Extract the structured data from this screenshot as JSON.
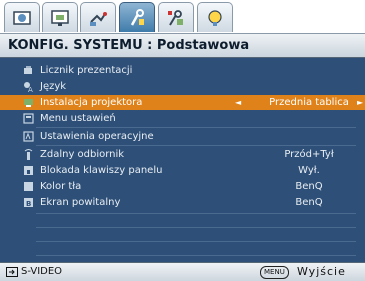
{
  "tabs": [
    {
      "icon": "picture-icon",
      "active": false
    },
    {
      "icon": "display-icon",
      "active": false
    },
    {
      "icon": "connection-icon",
      "active": false
    },
    {
      "icon": "system-setup-icon",
      "active": true
    },
    {
      "icon": "advanced-setup-icon",
      "active": false
    },
    {
      "icon": "information-icon",
      "active": false
    }
  ],
  "title": "KONFIG. SYSTEMU : Podstawowa",
  "menu": {
    "items": [
      {
        "label": "Licznik prezentacji",
        "value": "",
        "icon": "timer-icon"
      },
      {
        "label": "Język",
        "value": "",
        "icon": "language-icon"
      },
      {
        "label": "Instalacja projektora",
        "value": "Przednia tablica",
        "icon": "projector-install-icon",
        "selected": true
      },
      {
        "label": "Menu ustawień",
        "value": "",
        "icon": "menu-settings-icon"
      },
      {
        "label": "Ustawienia operacyjne",
        "value": "",
        "icon": "operation-settings-icon"
      },
      {
        "label": "Zdalny odbiornik",
        "value": "Przód+Tył",
        "icon": "remote-receiver-icon"
      },
      {
        "label": "Blokada klawiszy panelu",
        "value": "Wył.",
        "icon": "panel-lock-icon"
      },
      {
        "label": "Kolor tła",
        "value": "BenQ",
        "icon": "background-color-icon"
      },
      {
        "label": "Ekran powitalny",
        "value": "BenQ",
        "icon": "splash-screen-icon"
      }
    ]
  },
  "status": {
    "source_label": "S-VIDEO",
    "menu_key": "MENU",
    "exit_label": "Wyjście"
  },
  "colors": {
    "panel_bg": "#2e4f77",
    "selected_bg": "#e0821a",
    "active_tab": "#3f7cab"
  }
}
